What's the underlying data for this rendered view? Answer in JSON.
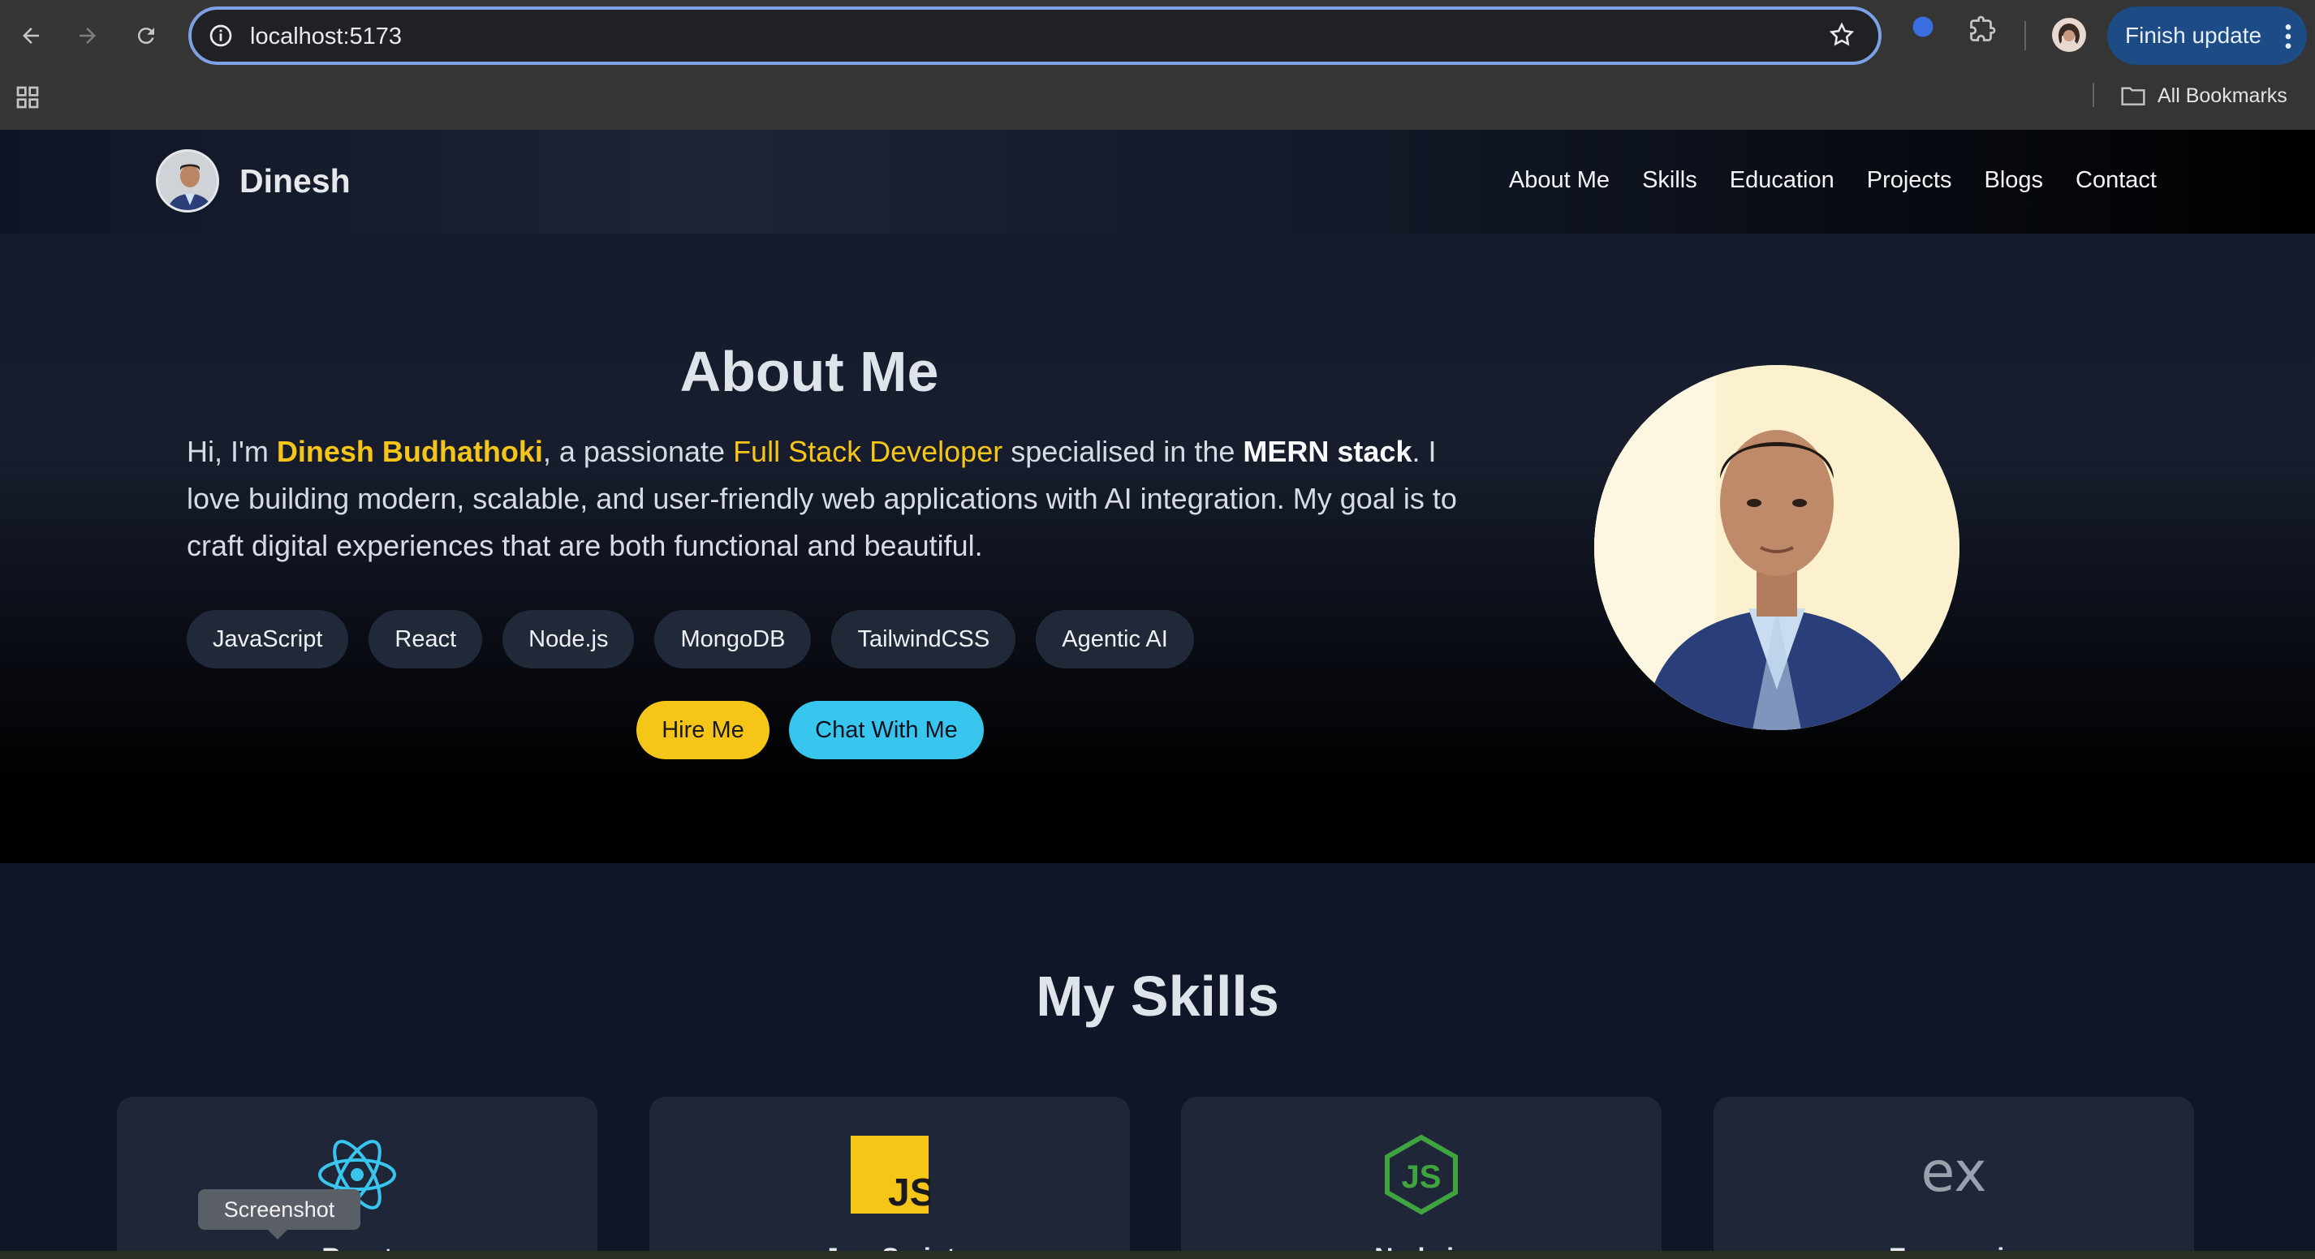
{
  "browser": {
    "url": "localhost:5173",
    "finish_update_label": "Finish update",
    "all_bookmarks_label": "All Bookmarks"
  },
  "header": {
    "site_name": "Dinesh",
    "nav": [
      "About Me",
      "Skills",
      "Education",
      "Projects",
      "Blogs",
      "Contact"
    ]
  },
  "about": {
    "title": "About Me",
    "intro_prefix": "Hi, I'm ",
    "name": "Dinesh Budhathoki",
    "text_mid1": ", a passionate ",
    "role": "Full Stack Developer",
    "text_mid2": " specialised in the ",
    "stack": "MERN stack",
    "text_rest": ". I love building modern, scalable, and user-friendly web applications with AI integration. My goal is to craft digital experiences that are both functional and beautiful.",
    "tags": [
      "JavaScript",
      "React",
      "Node.js",
      "MongoDB",
      "TailwindCSS",
      "Agentic AI"
    ],
    "hire_button": "Hire Me",
    "chat_button": "Chat With Me"
  },
  "skills": {
    "title": "My Skills",
    "cards": [
      {
        "label": "React",
        "icon": "react-icon"
      },
      {
        "label": "JavaScript",
        "icon": "javascript-icon"
      },
      {
        "label": "Node.js",
        "icon": "nodejs-icon"
      },
      {
        "label": "Express.js",
        "icon": "express-icon"
      }
    ]
  },
  "tooltip": "Screenshot",
  "colors": {
    "accent_yellow": "#f5c518",
    "accent_cyan": "#38c6ee",
    "browser_chrome": "#353535",
    "page_bg": "#0f1627"
  }
}
